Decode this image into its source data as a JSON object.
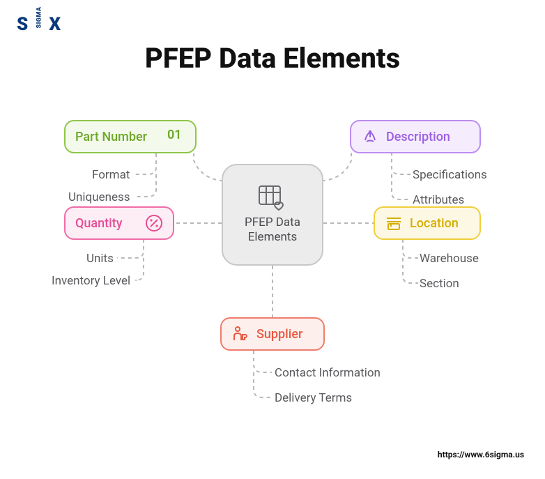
{
  "logo": {
    "text": "S X",
    "sigma": "SIGMA"
  },
  "title": "PFEP Data Elements",
  "center": {
    "label": "PFEP Data\nElements"
  },
  "branches": {
    "part_number": {
      "label": "Part Number",
      "icon_badge": "01",
      "subs": [
        "Format",
        "Uniqueness"
      ]
    },
    "quantity": {
      "label": "Quantity",
      "subs": [
        "Units",
        "Inventory Level"
      ]
    },
    "supplier": {
      "label": "Supplier",
      "subs": [
        "Contact Information",
        "Delivery Terms"
      ]
    },
    "location": {
      "label": "Location",
      "subs": [
        "Warehouse",
        "Section"
      ]
    },
    "description": {
      "label": "Description",
      "subs": [
        "Specifications",
        "Attributes"
      ]
    }
  },
  "footer_url": "https://www.6sigma.us"
}
